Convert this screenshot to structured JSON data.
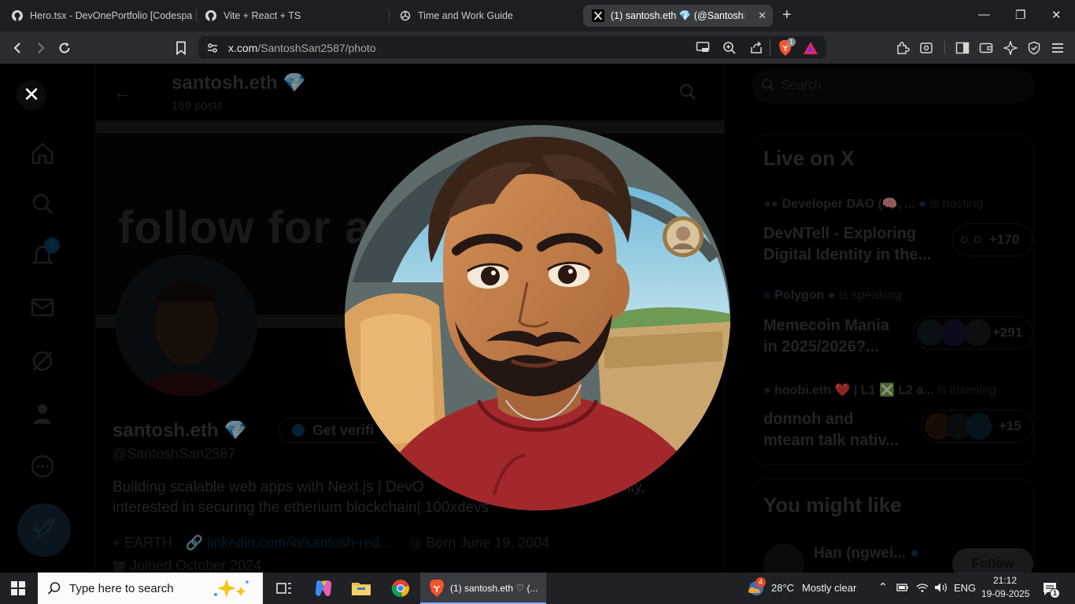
{
  "browser": {
    "tabs": [
      {
        "title": "Hero.tsx - DevOnePortfolio [Codespa",
        "icon": "github-icon",
        "active": false
      },
      {
        "title": "Vite + React + TS",
        "icon": "github-icon",
        "active": false
      },
      {
        "title": "Time and Work Guide",
        "icon": "chatgpt-icon",
        "active": false
      },
      {
        "title": "(1) santosh.eth 💎 (@SantoshSa",
        "icon": "x-icon",
        "active": true
      }
    ],
    "new_tab": "+",
    "url_host": "x.com",
    "url_path": "/SantoshSan2587/photo",
    "brave_badge": "1"
  },
  "page": {
    "header_name": "santosh.eth 💎",
    "header_posts": "169 posts",
    "banner_text": "follow for a",
    "profile_name": "santosh.eth 💎",
    "get_verified": "Get verifi",
    "handle": "@SantoshSan2587",
    "bio_line1": "Building scalable web apps with Next.js | DevO",
    "bio_line1_end": "ulity,",
    "bio_line2": "interested in securing the etherium blockchain| 100xdevs",
    "location": "EARTH",
    "link": "linkedin.com/in/santosh-red...",
    "born": "Born June 19, 2004",
    "joined": "Joined October 2024",
    "notif_badge": "1",
    "search_placeholder": "Search",
    "live_title": "Live on X",
    "live": [
      {
        "host": "Developer DAO (🧠, ...",
        "status": "is hosting",
        "title1": "DevNTell - Exploring",
        "title2": "Digital Identity in the...",
        "count": "+170",
        "chip": "D_D"
      },
      {
        "host": "Polygon",
        "status": "is speaking",
        "title1": "Memecoin Mania",
        "title2": "in 2025/2026?...",
        "count": "+291",
        "chip": ""
      },
      {
        "host": "hoobi.eth ❤️ | L1 ❎ L2 a...",
        "status": "is listening",
        "title1": "donnoh and",
        "title2": "mteam talk nativ...",
        "count": "+15",
        "chip": ""
      }
    ],
    "might_like_title": "You might like",
    "suggest_name": "Han (ngwei...",
    "follow_label": "Follow"
  },
  "taskbar": {
    "search_placeholder": "Type here to search",
    "brave_label": "(1) santosh.eth ♡ (...",
    "weather_temp": "28°C",
    "weather_desc": "Mostly clear",
    "weather_badge": "4",
    "lang": "ENG",
    "time": "21:12",
    "date": "19-09-2025",
    "notif_count": "1"
  },
  "colors": {
    "accent": "#1d9bf0",
    "shirt": "#a3282b",
    "skin": "#c6804a",
    "hair": "#3a2418"
  }
}
